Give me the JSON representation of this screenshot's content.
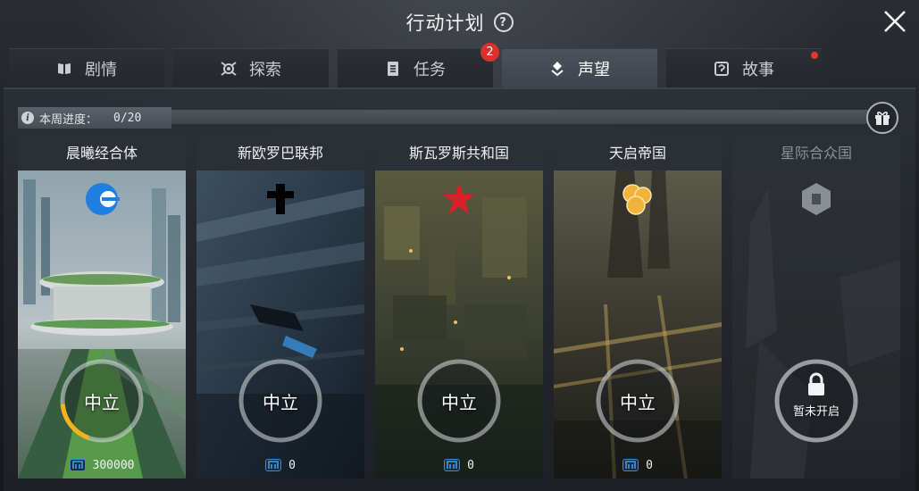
{
  "header": {
    "title": "行动计划",
    "help_label": "?"
  },
  "tabs": [
    {
      "label": "剧情",
      "icon": "book-icon",
      "active": false
    },
    {
      "label": "探索",
      "icon": "explore-icon",
      "active": false
    },
    {
      "label": "任务",
      "icon": "task-icon",
      "active": false,
      "badge": "2"
    },
    {
      "label": "声望",
      "icon": "reputation-icon",
      "active": true
    },
    {
      "label": "故事",
      "icon": "story-icon",
      "active": false,
      "dot": true
    }
  ],
  "progress": {
    "label": "本周进度：",
    "value": "0/20",
    "current": 0,
    "max": 20,
    "info_icon": "info-icon"
  },
  "gift_button": {
    "icon": "gift-icon"
  },
  "factions": [
    {
      "name": "晨曦经合体",
      "emblem": "dawn-emblem-icon",
      "status": "中立",
      "reputation": "300000",
      "progress_fraction": 0.18,
      "locked": false,
      "accent": "#1e7fe0"
    },
    {
      "name": "新欧罗巴联邦",
      "emblem": "cross-emblem-icon",
      "status": "中立",
      "reputation": "0",
      "progress_fraction": 0,
      "locked": false,
      "accent": "#000000"
    },
    {
      "name": "斯瓦罗斯共和国",
      "emblem": "red-star-emblem-icon",
      "status": "中立",
      "reputation": "0",
      "progress_fraction": 0,
      "locked": false,
      "accent": "#d91f2a"
    },
    {
      "name": "天启帝国",
      "emblem": "orbs-emblem-icon",
      "status": "中立",
      "reputation": "0",
      "progress_fraction": 0,
      "locked": false,
      "accent": "#f2b33a"
    },
    {
      "name": "星际合众国",
      "emblem": "hexagon-emblem-icon",
      "status": "暂未开启",
      "reputation": "",
      "locked": true,
      "accent": "#9a9fa5"
    }
  ],
  "colors": {
    "ring_progress": "#f5b21c",
    "active_tab": "#454c53",
    "badge": "#d8322b"
  }
}
